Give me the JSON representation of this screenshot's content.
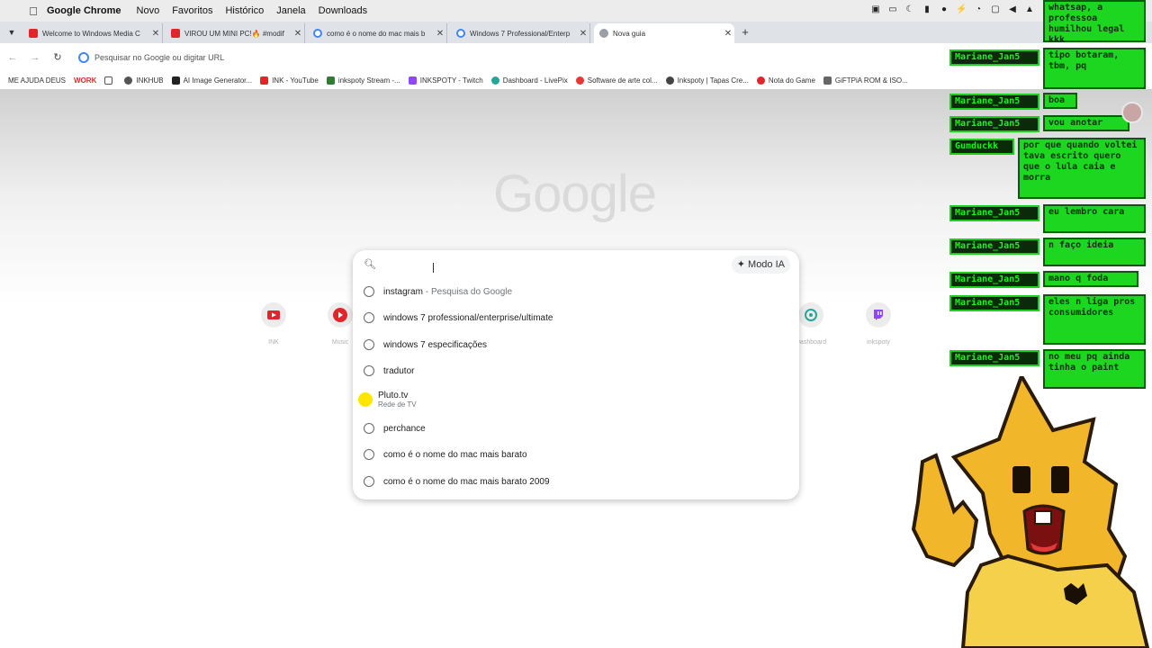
{
  "macos_menubar": {
    "app_name": "Google Chrome",
    "menus": [
      "Novo",
      "Favoritos",
      "Histórico",
      "Janela",
      "Downloads"
    ]
  },
  "tabs": [
    {
      "title": "Welcome to Windows Media C",
      "icon": "youtube-icon"
    },
    {
      "title": "VIROU UM MINI PC!🔥 #modif",
      "icon": "youtube-icon"
    },
    {
      "title": "como é o nome do mac mais b",
      "icon": "google-icon"
    },
    {
      "title": "Windows 7 Professional/Enterp",
      "icon": "google-icon"
    },
    {
      "title": "Nova guia",
      "icon": "chrome-icon",
      "active": true
    }
  ],
  "omnibox": {
    "placeholder": "Pesquisar no Google ou digitar URL"
  },
  "bookmarks": [
    {
      "label": "ME AJUDA DEUS",
      "color": "#555555"
    },
    {
      "label": "WORK",
      "color": "#d0322b"
    },
    {
      "label": "INKHUB",
      "color": "#333333"
    },
    {
      "label": "AI Image Generator...",
      "color": "#333333"
    },
    {
      "label": "INK - YouTube",
      "color": "#e1262b"
    },
    {
      "label": "inkspoty Stream -...",
      "color": "#2e7d32"
    },
    {
      "label": "INKSPOTY - Twitch",
      "color": "#9146ff"
    },
    {
      "label": "Dashboard - LivePix",
      "color": "#26a69a"
    },
    {
      "label": "Software de arte col...",
      "color": "#e53935"
    },
    {
      "label": "Inkspoty | Tapas Cre...",
      "color": "#333333"
    },
    {
      "label": "Nota do Game",
      "color": "#e1262b"
    },
    {
      "label": "GiFTPiA ROM & ISO...",
      "color": "#333333"
    }
  ],
  "google_logo": "Google",
  "search": {
    "mode_label": "Modo IA",
    "suggestions": [
      {
        "text": "instagram",
        "extra": "- Pesquisa do Google"
      },
      {
        "text": "windows 7 professional/enterprise/ultimate"
      },
      {
        "text": "windows 7 especificações"
      },
      {
        "text": "tradutor"
      },
      {
        "text": "Pluto.tv",
        "sub": "Rede de TV"
      },
      {
        "text": "perchance"
      },
      {
        "text": "como é o nome do mac mais barato"
      },
      {
        "text": "como é o nome do mac mais barato 2009"
      }
    ]
  },
  "shortcuts": [
    {
      "label": "INK",
      "icon": "youtube-icon",
      "color": "#e1262b"
    },
    {
      "label": "Music",
      "icon": "youtube-music-icon",
      "color": "#e1262b"
    },
    {
      "label": "Dashboard",
      "icon": "livepix-icon",
      "color": "#26a69a"
    },
    {
      "label": "inkspoty",
      "icon": "twitch-icon",
      "color": "#9146ff"
    }
  ],
  "chat": [
    {
      "user": "",
      "message": "whatsap, a professoa humilhou legal kkk"
    },
    {
      "user": "Mariane_Jan5",
      "message": "tipo botaram, tbm, pq"
    },
    {
      "user": "Mariane_Jan5",
      "message": "boa"
    },
    {
      "user": "Mariane_Jan5",
      "message": "vou anotar"
    },
    {
      "user": "Gumduckk",
      "message": "por que quando voltei tava escrito quero que o lula caia e morra"
    },
    {
      "user": "Mariane_Jan5",
      "message": "eu lembro cara"
    },
    {
      "user": "Mariane_Jan5",
      "message": "n faço ideia"
    },
    {
      "user": "Mariane_Jan5",
      "message": "mano q foda"
    },
    {
      "user": "Mariane_Jan5",
      "message": "eles n liga pros consumidores"
    },
    {
      "user": "Mariane_Jan5",
      "message": "no meu pq ainda tinha o paint"
    }
  ]
}
